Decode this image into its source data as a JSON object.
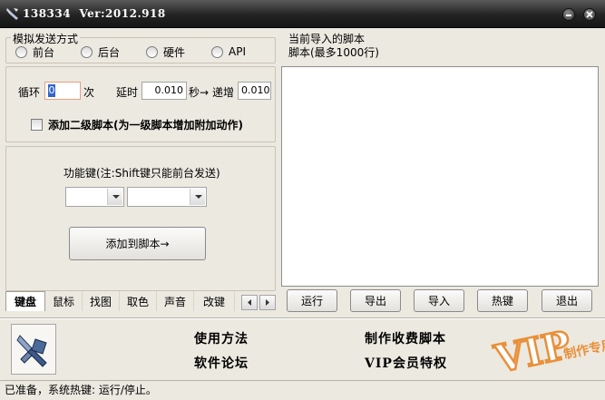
{
  "window": {
    "title": "138334  Ver:2012.918"
  },
  "send_mode": {
    "title": "模拟发送方式",
    "options": [
      "前台",
      "后台",
      "硬件",
      "API"
    ]
  },
  "loop": {
    "loop_label": "循环",
    "loop_value": "0",
    "times_label": "次",
    "delay_label": "延时",
    "delay_value": "0.010",
    "seconds_arrow_label": "秒→",
    "increment_label": "递增",
    "increment_value": "0.010"
  },
  "secondary_script": {
    "label": "添加二级脚本(为一级脚本增加附加动作)",
    "checked": false
  },
  "function_key": {
    "label": "功能键(注:Shift键只能前台发送)",
    "add_button": "添加到脚本→"
  },
  "tabs": [
    "键盘",
    "鼠标",
    "找图",
    "取色",
    "声音",
    "改键"
  ],
  "active_tab": "键盘",
  "script_panel": {
    "title": "当前导入的脚本",
    "subtitle": "脚本(最多1000行)"
  },
  "actions": [
    "运行",
    "导出",
    "导入",
    "热键",
    "退出"
  ],
  "footer_links": {
    "usage": "使用方法",
    "forum": "软件论坛",
    "paid_script": "制作收费脚本",
    "vip": "VIP会员特权"
  },
  "vip_badge": {
    "text": "VIP",
    "sub_text": "制作专用"
  },
  "status": "已准备，系统热键: 运行/停止。",
  "colors": {
    "title_bg": "#1e1e1e",
    "panel_bg": "#ece9e1",
    "vip_orange": "#e8903a"
  }
}
